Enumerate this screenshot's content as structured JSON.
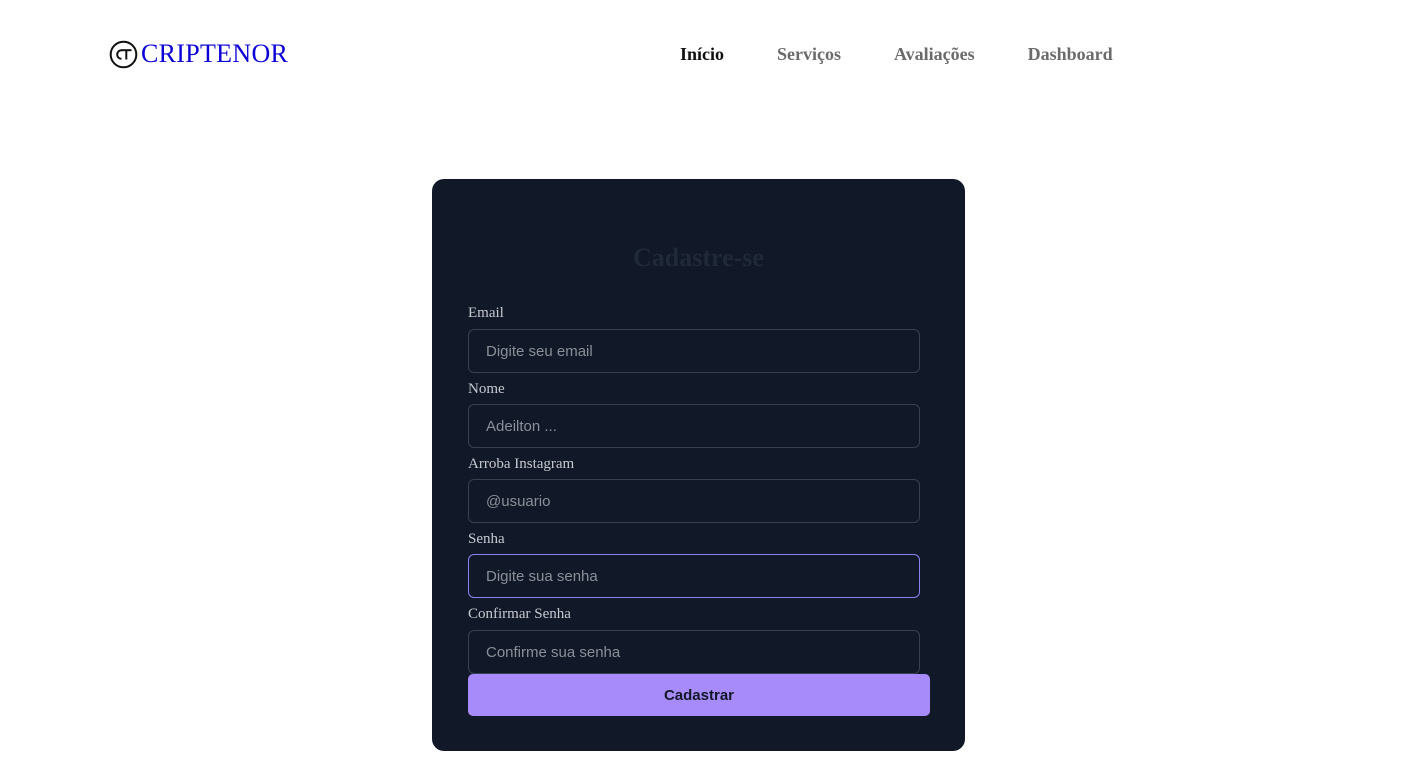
{
  "brand": {
    "name": "CRIPTENOR",
    "logo_icon": "ct-circle-logo-icon",
    "color": "#0b00d6"
  },
  "nav": {
    "items": [
      {
        "label": "Início",
        "active": true
      },
      {
        "label": "Serviços",
        "active": false
      },
      {
        "label": "Avaliações",
        "active": false
      },
      {
        "label": "Dashboard",
        "active": false
      }
    ]
  },
  "form": {
    "title": "Cadastre-se",
    "fields": [
      {
        "label": "Email",
        "placeholder": "Digite seu email",
        "value": ""
      },
      {
        "label": "Nome",
        "placeholder": "Adeilton ...",
        "value": ""
      },
      {
        "label": "Arroba Instagram",
        "placeholder": "@usuario",
        "value": ""
      },
      {
        "label": "Senha",
        "placeholder": "Digite sua senha",
        "value": "",
        "focused": true
      },
      {
        "label": "Confirmar Senha",
        "placeholder": "Confirme sua senha",
        "value": ""
      }
    ],
    "submit_label": "Cadastrar"
  },
  "colors": {
    "card_bg": "#111827",
    "accent": "#a78bfa",
    "focus_border": "#8b80f0"
  }
}
